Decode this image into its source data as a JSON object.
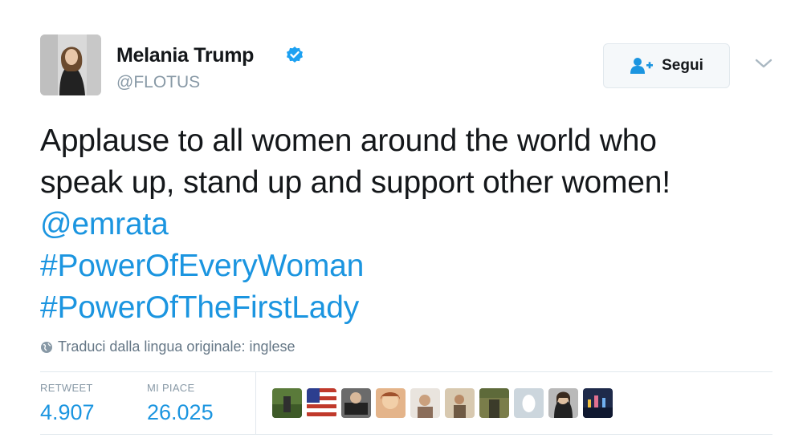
{
  "user": {
    "name": "Melania Trump",
    "handle": "@FLOTUS",
    "verified": true
  },
  "follow_button": {
    "label": "Segui",
    "icon": "person-plus-icon"
  },
  "tweet": {
    "line1": "Applause to all women around the world who",
    "line2": "speak up, stand up and support other women!",
    "mention": "@emrata",
    "hashtag1": "#PowerOfEveryWoman",
    "hashtag2": "#PowerOfTheFirstLady"
  },
  "translate": {
    "label": "Traduci dalla lingua originale: inglese",
    "icon": "globe-icon"
  },
  "stats": {
    "retweet_label": "RETWEET",
    "retweet_count": "4.907",
    "like_label": "MI PIACE",
    "like_count": "26.025"
  },
  "colors": {
    "link": "#1b95e0",
    "text": "#14171a",
    "secondary": "#8899a6",
    "verified": "#1da1f2"
  }
}
